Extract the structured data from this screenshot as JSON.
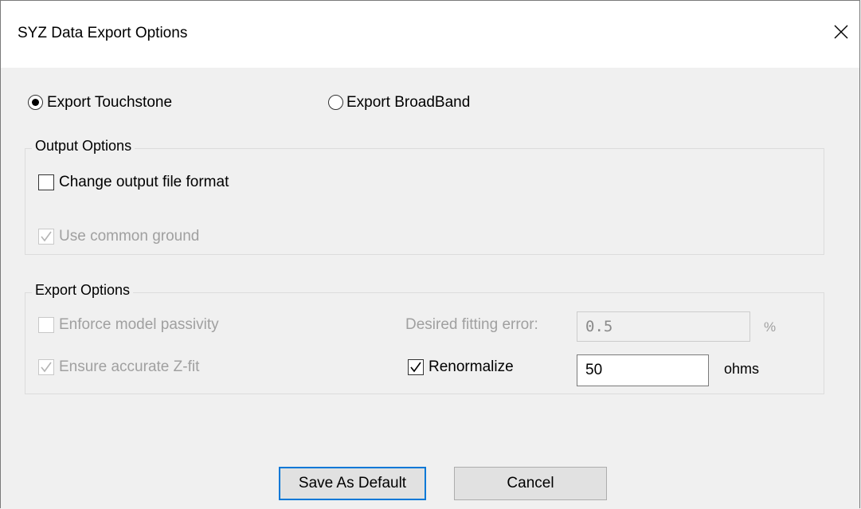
{
  "window": {
    "title": "SYZ Data Export Options",
    "close_icon": "close-icon"
  },
  "export_type": {
    "touchstone_label": "Export Touchstone",
    "touchstone_selected": true,
    "broadband_label": "Export BroadBand",
    "broadband_selected": false
  },
  "output_options": {
    "group_label": "Output Options",
    "change_format_label": "Change output file format",
    "change_format_checked": false,
    "common_ground_label": "Use common ground",
    "common_ground_checked": true,
    "common_ground_enabled": false
  },
  "export_options": {
    "group_label": "Export Options",
    "enforce_passivity_label": "Enforce model passivity",
    "enforce_passivity_checked": false,
    "enforce_passivity_enabled": false,
    "fitting_error_label": "Desired fitting error:",
    "fitting_error_value": "0.5",
    "fitting_error_unit": "%",
    "fitting_error_enabled": false,
    "accurate_zfit_label": "Ensure accurate Z-fit",
    "accurate_zfit_checked": true,
    "accurate_zfit_enabled": false,
    "renormalize_label": "Renormalize",
    "renormalize_checked": true,
    "renormalize_value": "50",
    "renormalize_unit": "ohms"
  },
  "buttons": {
    "save_default_label": "Save As Default",
    "cancel_label": "Cancel"
  },
  "colors": {
    "accent": "#0078d7",
    "disabled_text": "#a0a0a0"
  }
}
